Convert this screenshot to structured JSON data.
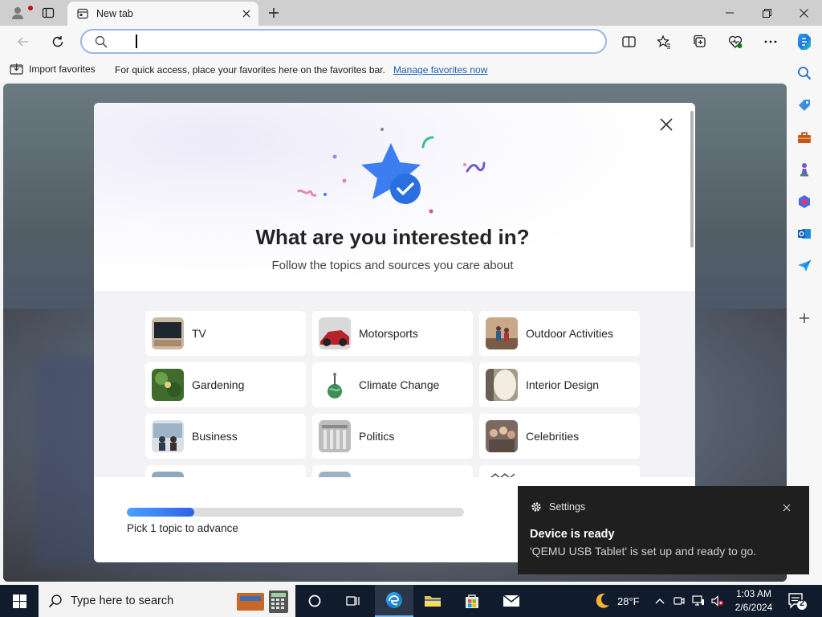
{
  "browser": {
    "tab": {
      "title": "New tab"
    },
    "address_bar": {
      "value": "",
      "placeholder": ""
    },
    "favorites_bar": {
      "import_label": "Import favorites",
      "message": "For quick access, place your favorites here on the favorites bar.",
      "manage_link": "Manage favorites now"
    }
  },
  "modal": {
    "title": "What are you interested in?",
    "subtitle": "Follow the topics and sources you care about",
    "topics": [
      {
        "label": "TV",
        "thumb_color": "#4b4237"
      },
      {
        "label": "Motorsports",
        "thumb_color": "#b8232b"
      },
      {
        "label": "Outdoor Activities",
        "thumb_color": "#9a7a63"
      },
      {
        "label": "Gardening",
        "thumb_color": "#4d7a3a"
      },
      {
        "label": "Climate Change",
        "thumb_color": "#3f8f5a"
      },
      {
        "label": "Interior Design",
        "thumb_color": "#c9b8a2"
      },
      {
        "label": "Business",
        "thumb_color": "#6e7f90"
      },
      {
        "label": "Politics",
        "thumb_color": "#9a9a9a"
      },
      {
        "label": "Celebrities",
        "thumb_color": "#8a6a5a"
      }
    ],
    "progress": {
      "fraction": 0.2,
      "label": "Pick 1 topic to advance"
    }
  },
  "notification": {
    "app": "Settings",
    "title": "Device is ready",
    "body": "'QEMU USB Tablet' is set up and ready to go."
  },
  "taskbar": {
    "search_placeholder": "Type here to search",
    "weather": "28°F",
    "time": "1:03 AM",
    "date": "2/6/2024",
    "notification_count": "2"
  }
}
